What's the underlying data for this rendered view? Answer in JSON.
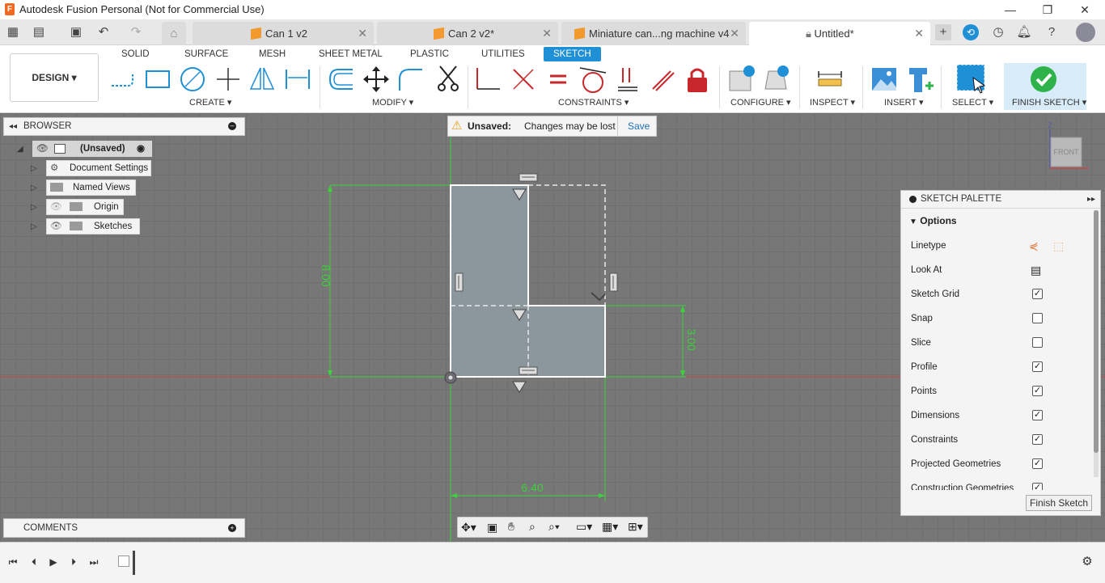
{
  "window": {
    "title": "Autodesk Fusion Personal (Not for Commercial Use)",
    "minimize": "—",
    "restore": "❐",
    "close": "✕"
  },
  "tabs": [
    {
      "label": "Can 1 v2",
      "close": "✕"
    },
    {
      "label": "Can 2 v2*",
      "close": "✕"
    },
    {
      "label": "Miniature can...ng machine v4",
      "close": "✕"
    },
    {
      "label": "Untitled*",
      "close": "✕"
    }
  ],
  "ribbon": {
    "workspace": "DESIGN ▾",
    "tabs": [
      "SOLID",
      "SURFACE",
      "MESH",
      "SHEET METAL",
      "PLASTIC",
      "UTILITIES",
      "SKETCH"
    ],
    "groups": {
      "create": "CREATE ▾",
      "modify": "MODIFY ▾",
      "constraints": "CONSTRAINTS ▾",
      "configure": "CONFIGURE ▾",
      "inspect": "INSPECT ▾",
      "insert": "INSERT ▾",
      "select": "SELECT ▾",
      "finish": "FINISH SKETCH ▾"
    }
  },
  "browser": {
    "title": "BROWSER",
    "root": "(Unsaved)",
    "nodes": [
      "Document Settings",
      "Named Views",
      "Origin",
      "Sketches"
    ]
  },
  "notice": {
    "label": "Unsaved:",
    "message": "Changes may be lost",
    "action": "Save"
  },
  "sketch": {
    "dim_height": "8.00",
    "dim_right": "3.00",
    "dim_width": "6.40",
    "accent": "#3dd13d"
  },
  "viewcube": {
    "face": "FRONT",
    "axis": "Z"
  },
  "palette": {
    "title": "SKETCH PALETTE",
    "section": "Options",
    "rows": [
      {
        "label": "Linetype",
        "checked": null
      },
      {
        "label": "Look At",
        "checked": null
      },
      {
        "label": "Sketch Grid",
        "checked": true
      },
      {
        "label": "Snap",
        "checked": false
      },
      {
        "label": "Slice",
        "checked": false
      },
      {
        "label": "Profile",
        "checked": true
      },
      {
        "label": "Points",
        "checked": true
      },
      {
        "label": "Dimensions",
        "checked": true
      },
      {
        "label": "Constraints",
        "checked": true
      },
      {
        "label": "Projected Geometries",
        "checked": true
      },
      {
        "label": "Construction Geometries",
        "checked": true
      }
    ],
    "finish_button": "Finish Sketch"
  },
  "comments": {
    "title": "COMMENTS"
  }
}
